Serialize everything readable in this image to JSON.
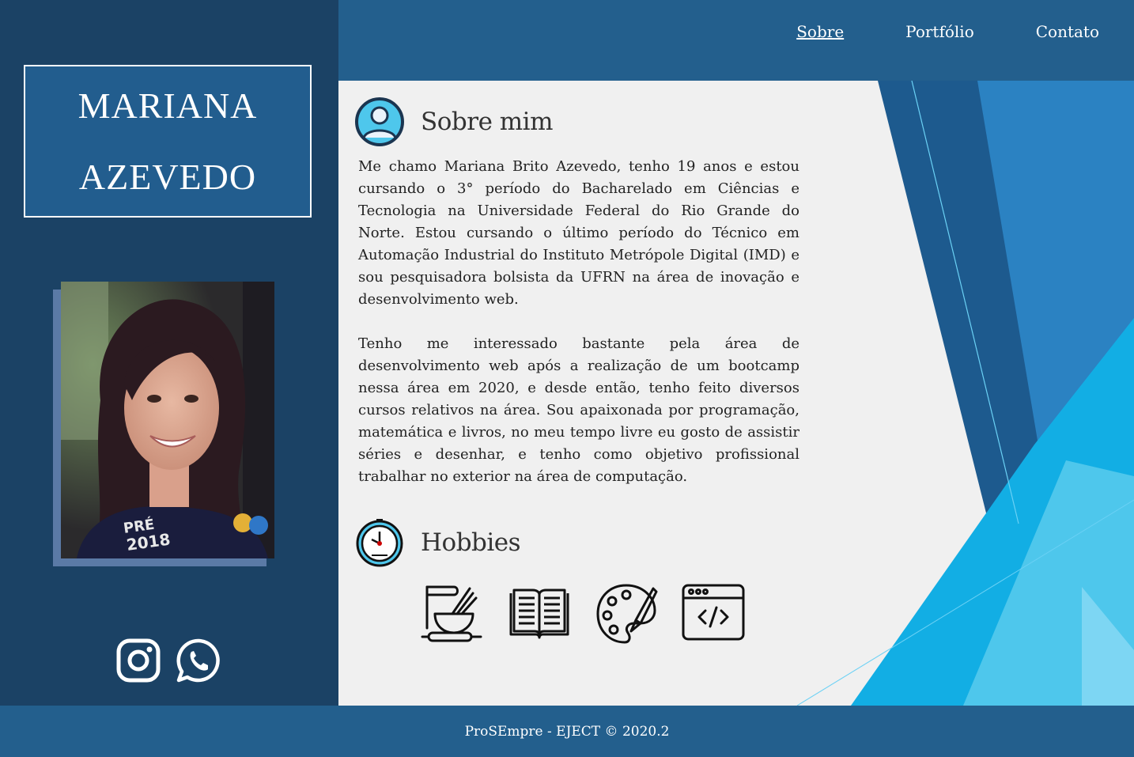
{
  "profile": {
    "first_name": "MARIANA",
    "last_name": "AZEVEDO",
    "photo_text_line1": "PRÉ",
    "photo_text_line2": "2018"
  },
  "nav": {
    "items": [
      {
        "label": "Sobre",
        "active": true
      },
      {
        "label": "Portfólio",
        "active": false
      },
      {
        "label": "Contato",
        "active": false
      }
    ]
  },
  "about": {
    "title": "Sobre mim",
    "paragraph1": "Me chamo Mariana Brito Azevedo, tenho 19 anos e estou cursando o 3° período do Bacharelado em Ciências e Tecnologia na Universidade Federal do Rio Grande do Norte. Estou cursando o último período do Técnico em Automação Industrial do Instituto Metrópole Digital (IMD) e sou pesquisadora bolsista da UFRN na área de inovação e desenvolvimento web.",
    "paragraph2": "Tenho me interessado bastante pela área de desenvolvimento web após a realização de um bootcamp nessa área em 2020, e desde então, tenho feito diversos cursos relativos na área. Sou apaixonada por programação, matemática e livros, no meu tempo livre eu gosto de assistir séries e desenhar, e tenho como objetivo profissional trabalhar no exterior na área de computação."
  },
  "hobbies": {
    "title": "Hobbies",
    "icons": [
      "baking-icon",
      "book-icon",
      "palette-icon",
      "code-window-icon"
    ]
  },
  "social": {
    "icons": [
      "instagram-icon",
      "whatsapp-icon"
    ]
  },
  "footer": {
    "text": "ProSEmpre - EJECT © 2020.2"
  },
  "colors": {
    "sidebar": "#1b4265",
    "topbar": "#235f8d",
    "content_bg": "#f0f0f0",
    "accent_light": "#4ec7ec"
  }
}
